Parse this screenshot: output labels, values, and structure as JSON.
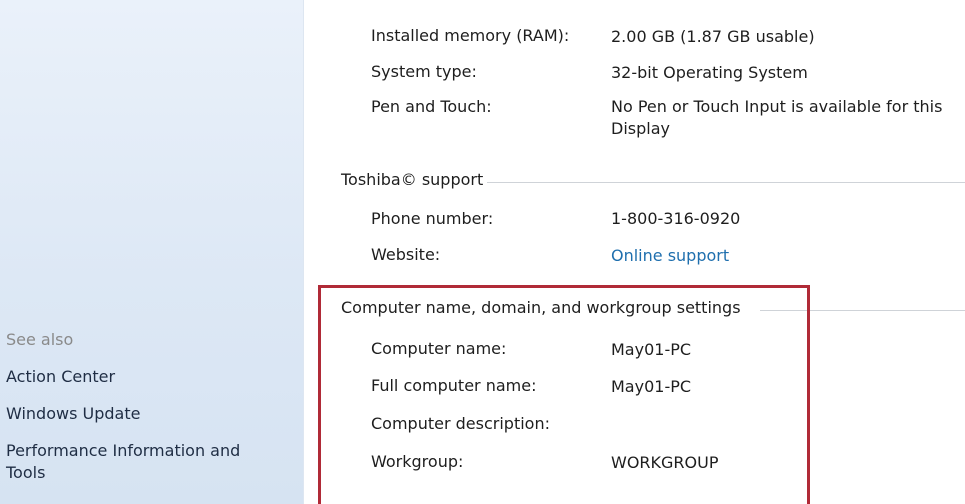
{
  "sidebar": {
    "see_also": "See also",
    "links": [
      {
        "label": "Action Center"
      },
      {
        "label": "Windows Update"
      },
      {
        "label": "Performance Information and Tools"
      }
    ]
  },
  "system": {
    "rows": [
      {
        "label": "Installed memory (RAM):",
        "value": "2.00 GB (1.87 GB usable)"
      },
      {
        "label": "System type:",
        "value": "32-bit Operating System"
      },
      {
        "label": "Pen and Touch:",
        "value": "No Pen or Touch Input is available for this Display"
      }
    ]
  },
  "support": {
    "title": "Toshiba© support",
    "rows": [
      {
        "label": "Phone number:",
        "value": "1-800-316-0920"
      },
      {
        "label": "Website:",
        "value": "Online support"
      }
    ]
  },
  "computer": {
    "title": "Computer name, domain, and workgroup settings",
    "rows": [
      {
        "label": "Computer name:",
        "value": "May01-PC"
      },
      {
        "label": "Full computer name:",
        "value": "May01-PC"
      },
      {
        "label": "Computer description:",
        "value": ""
      },
      {
        "label": "Workgroup:",
        "value": "WORKGROUP"
      }
    ]
  },
  "colors": {
    "sidebar_bg": "#dde8f5",
    "link": "#1f6fae",
    "highlight": "#b02a37"
  }
}
